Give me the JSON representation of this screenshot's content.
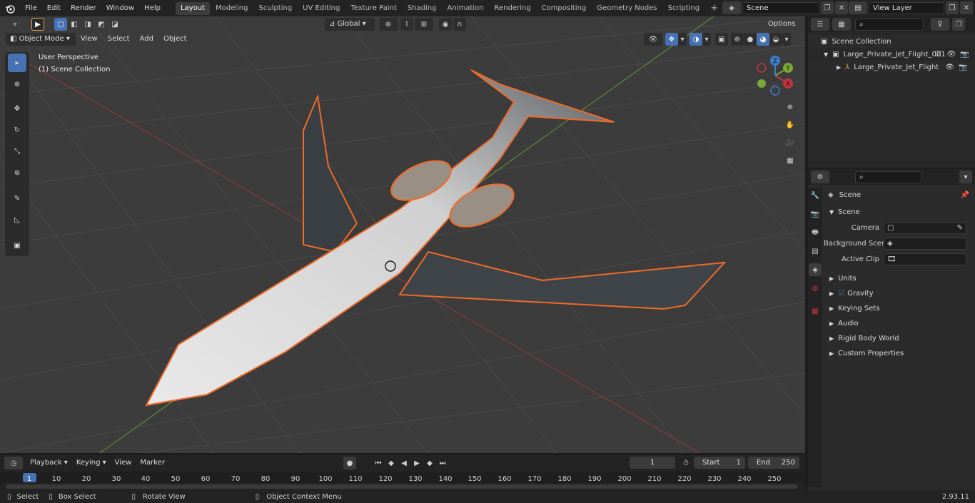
{
  "menu": {
    "file": "File",
    "edit": "Edit",
    "render": "Render",
    "window": "Window",
    "help": "Help"
  },
  "workspaces": [
    "Layout",
    "Modeling",
    "Sculpting",
    "UV Editing",
    "Texture Paint",
    "Shading",
    "Animation",
    "Rendering",
    "Compositing",
    "Geometry Nodes",
    "Scripting"
  ],
  "scene_name": "Scene",
  "view_layer": "View Layer",
  "viewport": {
    "mode": "Object Mode",
    "menus": [
      "View",
      "Select",
      "Add",
      "Object"
    ],
    "orientation": "Global",
    "options": "Options",
    "perspective": "User Perspective",
    "collection": "(1) Scene Collection",
    "gizmo": {
      "x": "X",
      "y": "Y",
      "z": "Z"
    }
  },
  "outliner": {
    "root": "Scene Collection",
    "items": [
      {
        "name": "Large_Private_Jet_Flight_001"
      },
      {
        "name": "Large_Private_Jet_Flight"
      }
    ]
  },
  "properties": {
    "header": "Scene",
    "panel": "Scene",
    "camera_label": "Camera",
    "bg_scene_label": "Background Scene",
    "active_clip_label": "Active Clip",
    "sections": [
      "Units",
      "Gravity",
      "Keying Sets",
      "Audio",
      "Rigid Body World",
      "Custom Properties"
    ]
  },
  "timeline": {
    "menus": [
      "Playback",
      "Keying",
      "View",
      "Marker"
    ],
    "current_frame": "1",
    "start_label": "Start",
    "start": "1",
    "end_label": "End",
    "end": "250",
    "ticks": [
      "1",
      "10",
      "20",
      "30",
      "40",
      "50",
      "60",
      "70",
      "80",
      "90",
      "100",
      "110",
      "120",
      "130",
      "140",
      "150",
      "160",
      "170",
      "180",
      "190",
      "200",
      "210",
      "220",
      "230",
      "240",
      "250"
    ]
  },
  "status": {
    "select": "Select",
    "box_select": "Box Select",
    "rotate_view": "Rotate View",
    "context_menu": "Object Context Menu",
    "version": "2.93.11"
  },
  "colors": {
    "accent": "#4772b3",
    "selection": "#f06a28",
    "x_axis": "#c1363e",
    "y_axis": "#76a836"
  }
}
